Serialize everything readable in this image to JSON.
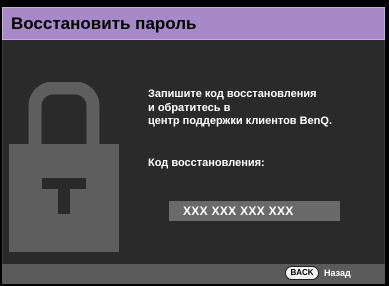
{
  "dialog": {
    "title": "Восстановить пароль",
    "message_lines": [
      "Запишите код восстановления",
      "и обратитесь в",
      "центр поддержки клиентов BenQ."
    ],
    "code_label": "Код восстановления:",
    "code_value": "XXX  XXX  XXX  XXX"
  },
  "footer": {
    "back_key": "BACK",
    "back_label": "Назад"
  },
  "colors": {
    "title_bg": "#a788c8",
    "content_bg": "#2a2a2a",
    "code_box_bg": "#6a6a6a",
    "footer_bg": "#5a5a5a"
  },
  "icons": {
    "main": "lock-icon"
  }
}
